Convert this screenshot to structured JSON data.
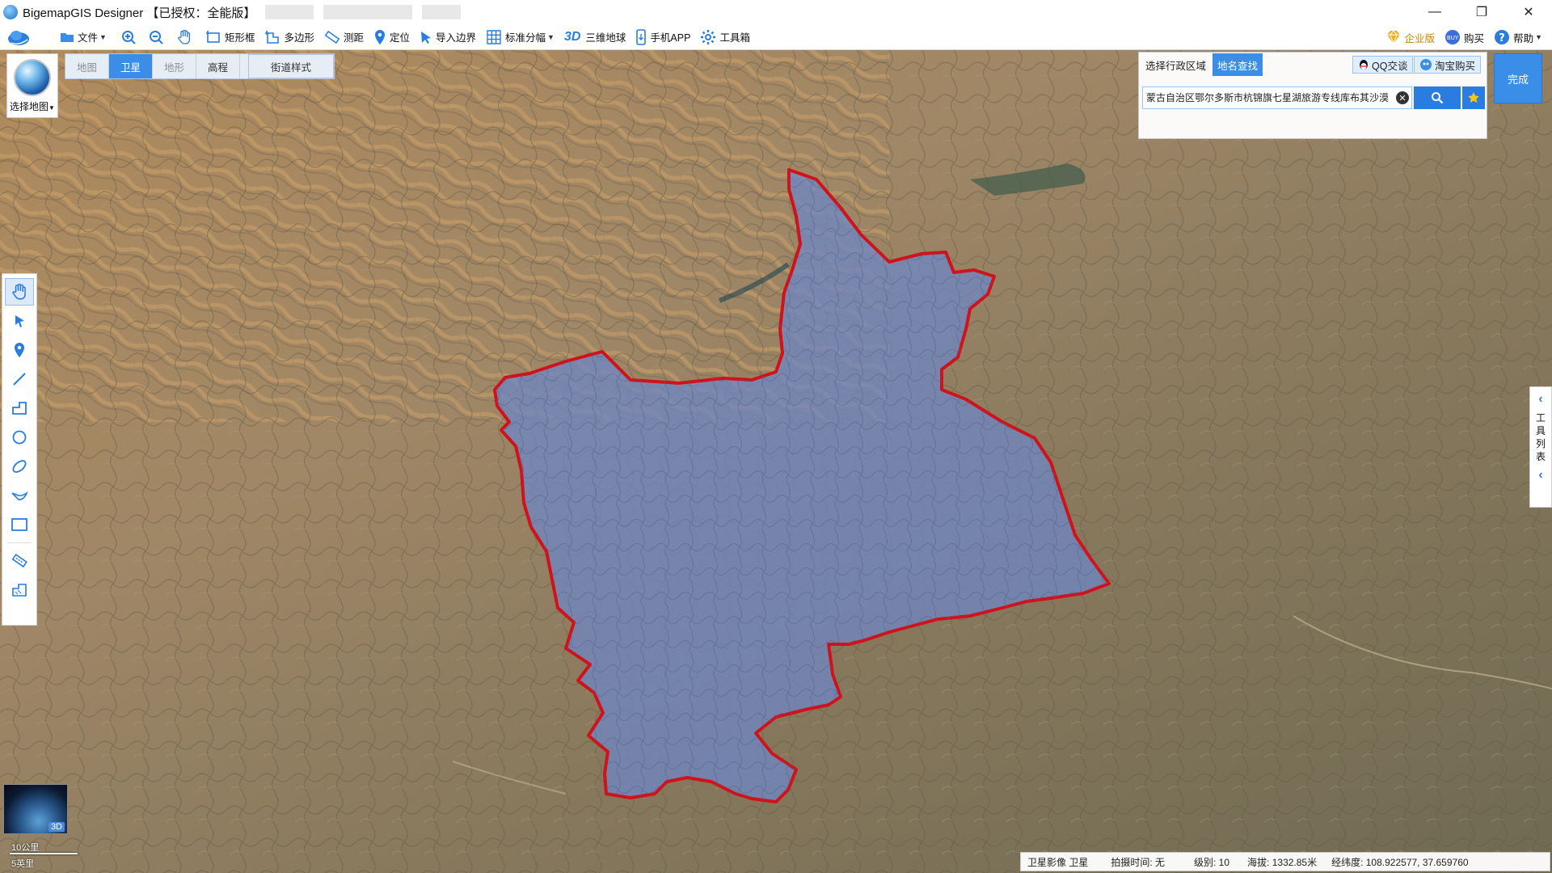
{
  "window": {
    "title": "BigemapGIS Designer 【已授权：全能版】",
    "minimize": "—",
    "restore": "❐",
    "close": "✕"
  },
  "toolbar": {
    "file": "文件",
    "rect": "矩形框",
    "polygon": "多边形",
    "measure": "测距",
    "locate": "定位",
    "import_boundary": "导入边界",
    "grid": "标准分幅",
    "earth3d": "三维地球",
    "mobile": "手机APP",
    "toolbox": "工具箱",
    "enterprise": "企业版",
    "buy": "购买",
    "help": "帮助"
  },
  "maptypes": {
    "items": [
      "地图",
      "卫星",
      "地形",
      "高程"
    ],
    "active": "卫星",
    "street": "街道样式"
  },
  "choose_map": {
    "label": "选择地图"
  },
  "search": {
    "tab_admin": "选择行政区域",
    "tab_place": "地名查找",
    "qq": "QQ交谈",
    "taobao": "淘宝购买",
    "query": "蒙古自治区鄂尔多斯市杭锦旗七星湖旅游专线库布其沙漠"
  },
  "done_button": "完成",
  "tool_list": {
    "label": "工具列表"
  },
  "minimap": {
    "badge": "3D"
  },
  "scale": {
    "km": "10公里",
    "mi": "5英里"
  },
  "status": {
    "source": "卫星影像 卫星",
    "shot_time": "拍摄时间: 无",
    "level": "级别:  10",
    "altitude": "海拔: 1332.85米",
    "coords": "经纬度:  108.922577, 37.659760"
  },
  "colors": {
    "accent": "#3b8ee8",
    "boundary": "#d0121a",
    "region_fill": "#6f86c2"
  }
}
